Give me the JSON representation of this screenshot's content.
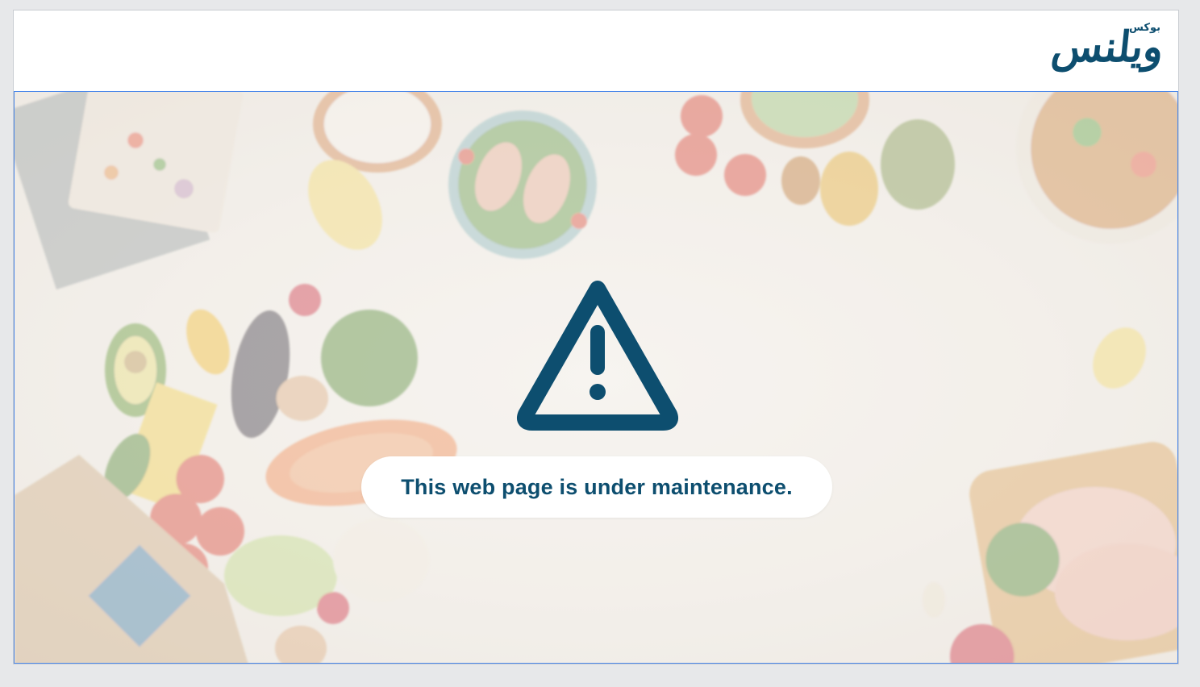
{
  "brand": {
    "name_small": "بوكس",
    "name_large": "ويلنس",
    "color": "#0d4e6f"
  },
  "notice": {
    "icon": "warning-triangle-icon",
    "message": "This web page is under maintenance.",
    "text_color": "#0d4e6f"
  },
  "hero": {
    "border_color": "#4a86e8"
  }
}
